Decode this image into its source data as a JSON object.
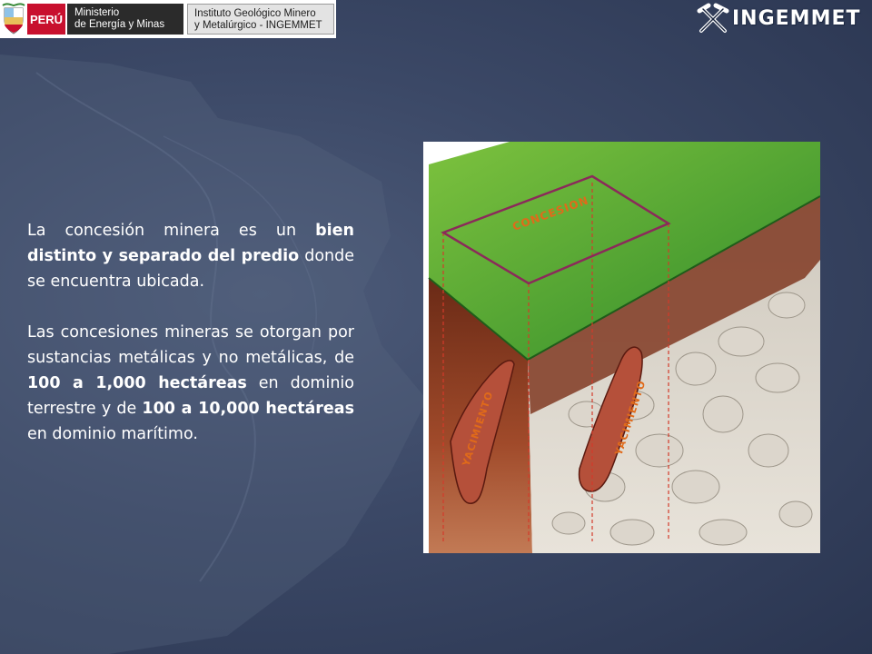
{
  "header": {
    "country": "PERÚ",
    "ministry_line1": "Ministerio",
    "ministry_line2": "de Energía y Minas",
    "institute_line1": "Instituto Geológico Minero",
    "institute_line2": "y Metalúrgico - INGEMMET",
    "brand": "INGEMMET"
  },
  "colors": {
    "background": "#3b4866",
    "peru_red": "#c8102e",
    "concession_outline": "#8b2a5a",
    "label_orange": "#e06a1a"
  },
  "paragraph1": {
    "t1": "La concesión minera es un ",
    "b1": "bien distinto y separado del predio",
    "t2": " donde se encuentra ubicada."
  },
  "paragraph2": {
    "t1": "Las concesiones mineras se otorgan por sustancias metálicas y no metálicas, de ",
    "b1": "100 a 1,000 hectáreas",
    "t2": " en dominio terrestre y de ",
    "b2": "100 a 10,000 hectáreas",
    "t3": " en dominio marítimo."
  },
  "figure": {
    "concession_label": "CONCESION",
    "deposit_label_left": "YACIMIENTO",
    "deposit_label_right": "YACIMIENTO"
  }
}
